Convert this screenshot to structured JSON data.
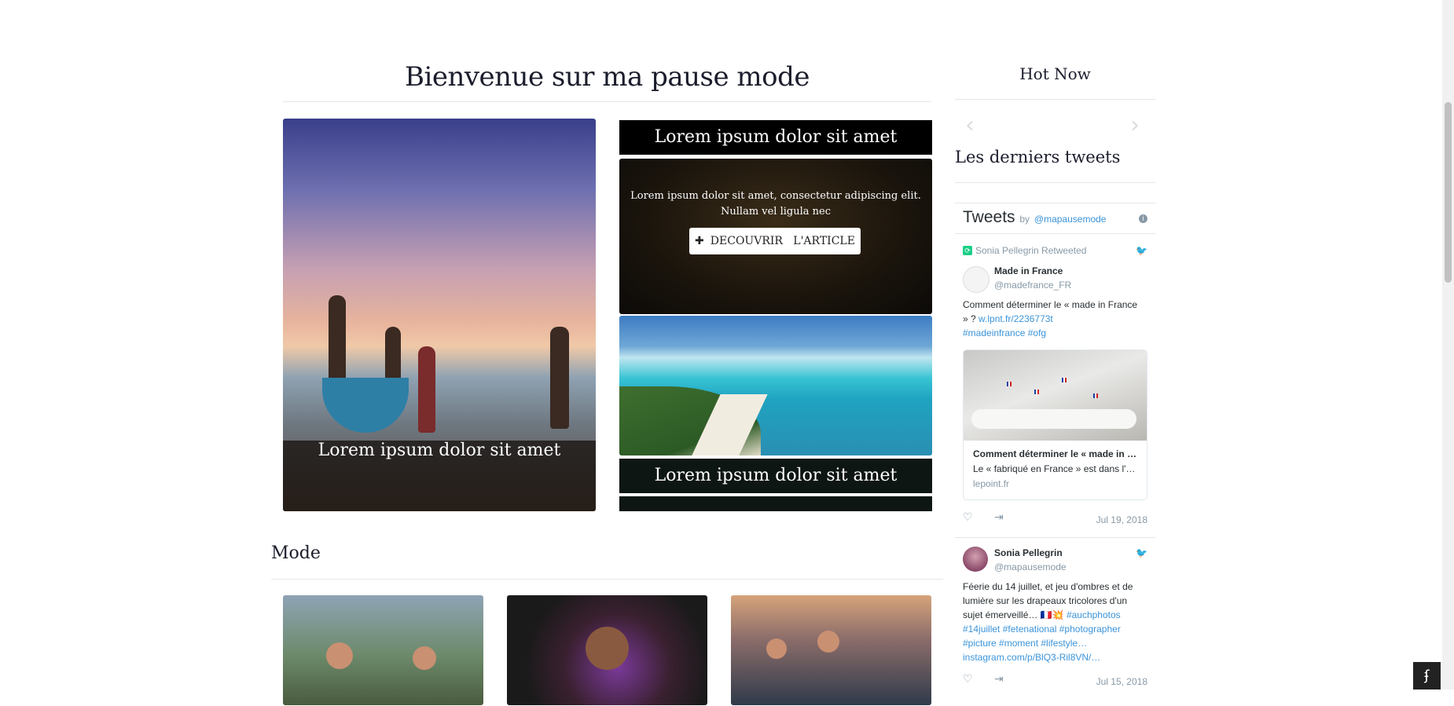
{
  "main": {
    "title": "Bienvenue sur ma pause mode",
    "hero_caption": "Lorem ipsum dolor sit amet",
    "top_bar_label": "Lorem ipsum dolor sit amet",
    "article_desc": "Lorem ipsum dolor sit amet, consectetur adipiscing elit. Nullam vel ligula nec",
    "discover_button": "DECOUVRIR   L'ARTICLE",
    "lagoon_caption": "Lorem ipsum dolor sit amet",
    "section_title": "Mode"
  },
  "sidebar": {
    "hot_title": "Hot Now",
    "prev_arrow": "‹",
    "next_arrow": "›",
    "tweets_section_title": "Les derniers tweets"
  },
  "twitter": {
    "header": "Tweets",
    "by": "by",
    "handle": "@mapausemode",
    "tweets": [
      {
        "retweeted_by": "Sonia Pellegrin Retweeted",
        "author": "Made in France",
        "handle": "@madefrance_FR",
        "text": "Comment déterminer le « made in France » ? ",
        "link": "w.lpnt.fr/2236773t",
        "hashtags": "#madeinfrance #ofg",
        "card_title": "Comment déterminer le « made in France » ?",
        "card_desc": "Le « fabriqué en France » est dans l'étiquette",
        "card_domain": "lepoint.fr",
        "date": "Jul 19, 2018"
      },
      {
        "author": "Sonia Pellegrin",
        "handle": "@mapausemode",
        "text": "Féerie du 14 juillet, et jeu d'ombres et de lumière sur les drapeaux tricolores d'un sujet émerveillé… 🇫🇷💥",
        "hashtags": "#auchphotos #14juillet #fetenational #photographer #picture #moment #lifestyle…",
        "link": "instagram.com/p/BlQ3-Ril8VN/…",
        "date": "Jul 15, 2018"
      }
    ]
  },
  "colors": {
    "accent_link": "#3b94d9",
    "retweet_green": "#19cf86",
    "text_dark": "#1b1d2c"
  }
}
